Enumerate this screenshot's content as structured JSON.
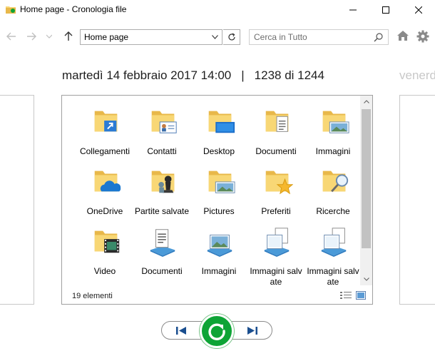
{
  "window": {
    "title": "Home page - Cronologia file",
    "app_icon": "file-history-icon"
  },
  "toolbar": {
    "address_value": "Home page",
    "search_placeholder": "Cerca in Tutto"
  },
  "header": {
    "date": "martedì 14 febbraio 2017 14:00",
    "separator": "|",
    "position": "1238 di 1244",
    "next_date": "venerdì"
  },
  "items": [
    {
      "label": "Collegamenti",
      "icon": "links-folder-icon"
    },
    {
      "label": "Contatti",
      "icon": "contacts-folder-icon"
    },
    {
      "label": "Desktop",
      "icon": "desktop-folder-icon"
    },
    {
      "label": "Documenti",
      "icon": "documents-folder-icon"
    },
    {
      "label": "Immagini",
      "icon": "pictures-folder-icon"
    },
    {
      "label": "OneDrive",
      "icon": "onedrive-folder-icon"
    },
    {
      "label": "Partite salvate",
      "icon": "saved-games-folder-icon"
    },
    {
      "label": "Pictures",
      "icon": "pictures-folder-icon"
    },
    {
      "label": "Preferiti",
      "icon": "favorites-folder-icon"
    },
    {
      "label": "Ricerche",
      "icon": "searches-folder-icon"
    },
    {
      "label": "Video",
      "icon": "videos-folder-icon"
    },
    {
      "label": "Documenti",
      "icon": "documents-library-icon"
    },
    {
      "label": "Immagini",
      "icon": "pictures-library-icon"
    },
    {
      "label": "Immagini salvate",
      "icon": "saved-pictures-library-icon"
    },
    {
      "label": "Immagini salvate",
      "icon": "saved-pictures-library-icon"
    }
  ],
  "status": {
    "count": "19 elementi"
  },
  "colors": {
    "folder": "#f8d775",
    "folder_dark": "#e8b84a",
    "accent_green": "#0ea436",
    "nav_blue": "#1a4e8f"
  }
}
